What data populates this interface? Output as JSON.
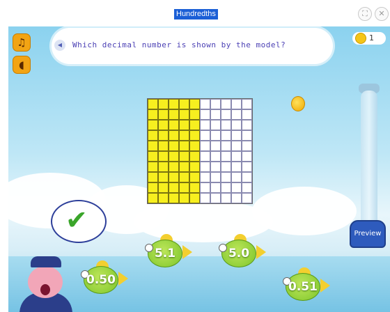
{
  "window": {
    "title": "Hundredths"
  },
  "question": {
    "text": "Which decimal number is shown by the model?"
  },
  "coins": {
    "count": "1"
  },
  "model": {
    "shaded": 50,
    "total": 100
  },
  "feedback": {
    "state": "correct"
  },
  "preview_label": "Preview",
  "answers": [
    {
      "label": "5.1"
    },
    {
      "label": "5.0"
    },
    {
      "label": "0.50"
    },
    {
      "label": "0.51"
    }
  ]
}
